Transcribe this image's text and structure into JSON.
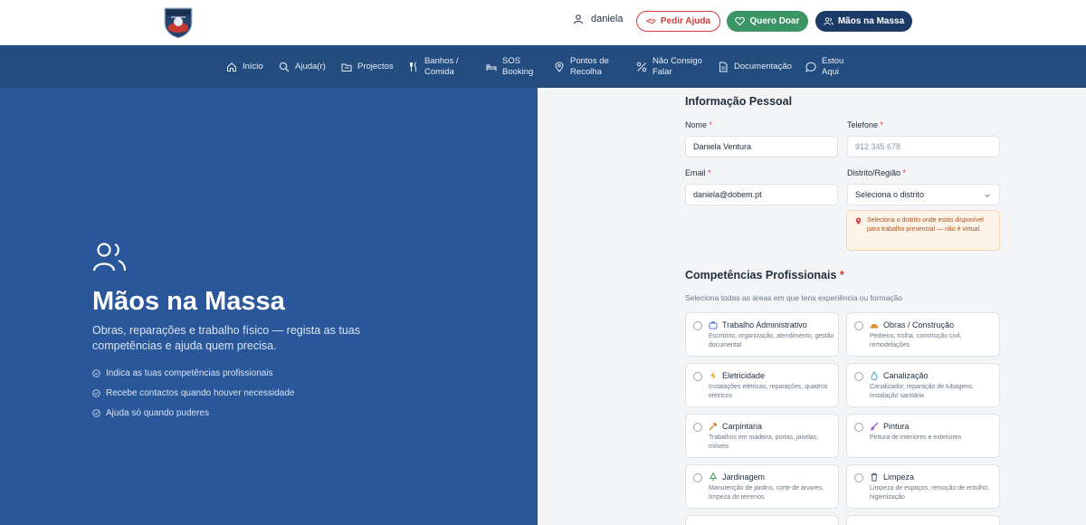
{
  "header": {
    "username": "daniela",
    "buttons": {
      "help": "Pedir Ajuda",
      "donate": "Quero Doar",
      "hands": "Mãos na Massa"
    }
  },
  "nav": [
    {
      "label": "Início",
      "icon": "home-icon"
    },
    {
      "label": "Ajuda(r)",
      "icon": "search-icon"
    },
    {
      "label": "Projectos",
      "icon": "folder-icon"
    },
    {
      "label": "Banhos /\nComida",
      "icon": "utensils-icon"
    },
    {
      "label": "SOS\nBooking",
      "icon": "bed-icon"
    },
    {
      "label": "Pontos de\nRecolha",
      "icon": "map-pin-icon"
    },
    {
      "label": "Não Consigo\nFalar",
      "icon": "percent-icon"
    },
    {
      "label": "Documentação",
      "icon": "document-icon"
    },
    {
      "label": "Estou\nAqui",
      "icon": "chat-icon"
    }
  ],
  "hero": {
    "title": "Mãos na Massa",
    "subtitle": "Obras, reparações e trabalho físico — regista as tuas competências e ajuda quem precisa.",
    "bullets": [
      "Indica as tuas competências profissionais",
      "Recebe contactos quando houver necessidade",
      "Ajuda só quando puderes"
    ]
  },
  "personal": {
    "title": "Informação Pessoal",
    "required_mark": "*",
    "name_label": "Nome",
    "name_value": "Daniela Ventura",
    "phone_label": "Telefone",
    "phone_placeholder": "912 345 678",
    "email_label": "Email",
    "email_value": "daniela@dobem.pt",
    "district_label": "Distrito/Região",
    "district_value": "Seleciona o distrito",
    "district_note": "Seleciona o distrito onde estás disponível para trabalho presencial — não é virtual."
  },
  "skills": {
    "title": "Competências Profissionais",
    "subtitle": "Seleciona todas as áreas em que tens experiência ou formação",
    "items": [
      {
        "title": "Trabalho Administrativo",
        "desc": "Escritório, organização, atendimento, gestão documental",
        "icon": "briefcase-icon",
        "color": "#4a79c9"
      },
      {
        "title": "Obras / Construção",
        "desc": "Pedreiro, trolha, construção civil, remodelações",
        "icon": "hard-hat-icon",
        "color": "#e08a2c"
      },
      {
        "title": "Eletricidade",
        "desc": "Instalações elétricas, reparações, quadros elétricos",
        "icon": "lightning-icon",
        "color": "#e8a21a"
      },
      {
        "title": "Canalização",
        "desc": "Canalizador, reparação de tubagens, instalação sanitária",
        "icon": "droplet-icon",
        "color": "#3aa0c8"
      },
      {
        "title": "Carpintaria",
        "desc": "Trabalhos em madeira, portas, janelas, móveis",
        "icon": "hammer-icon",
        "color": "#d4812a"
      },
      {
        "title": "Pintura",
        "desc": "Pintura de interiores e exteriores",
        "icon": "paintbrush-icon",
        "color": "#9a5bd6"
      },
      {
        "title": "Jardinagem",
        "desc": "Manutenção de jardins, corte de árvores, limpeza de terrenos",
        "icon": "tree-icon",
        "color": "#3aa05a"
      },
      {
        "title": "Limpeza",
        "desc": "Limpeza de espaços, remoção de entulho, higienização",
        "icon": "trash-icon",
        "color": "#556070"
      }
    ]
  }
}
